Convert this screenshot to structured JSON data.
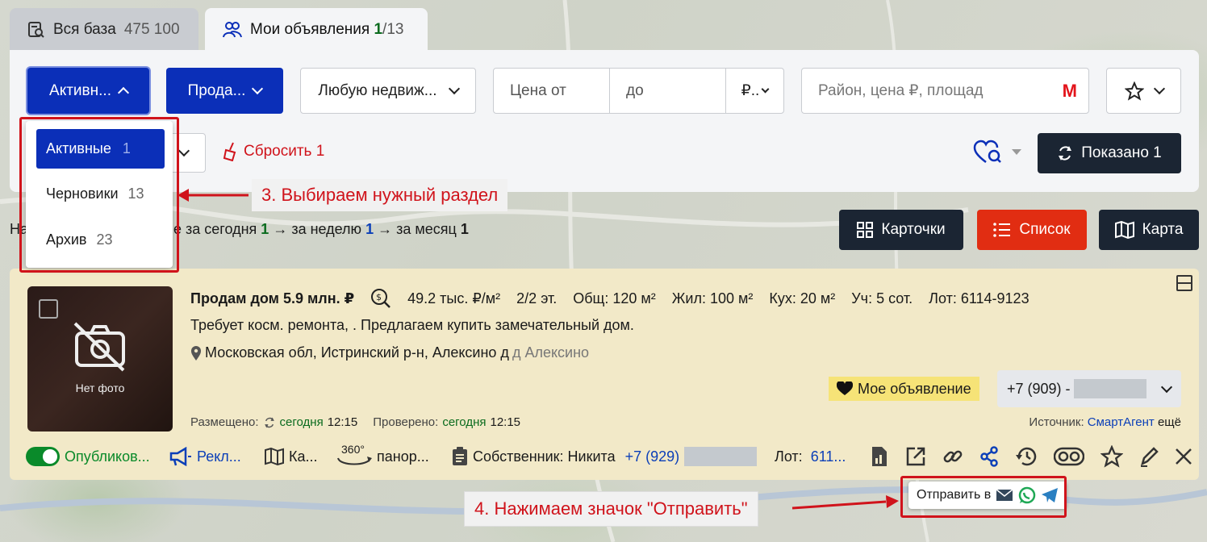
{
  "tabs": [
    {
      "label": "Вся база",
      "count": "475 100"
    },
    {
      "label": "Мои объявления",
      "active_count": "1",
      "total": "/13"
    }
  ],
  "filters": {
    "status": "Активн...",
    "deal": "Прода...",
    "property": "Любую недвиж...",
    "price_from": "Цена от",
    "price_to": "до",
    "currency": "₽..",
    "search_placeholder": "Район, цена ₽, площад",
    "metro_icon": "М",
    "reset": "Сбросить 1",
    "shown": "Показано 1"
  },
  "status_menu": [
    {
      "label": "Активные",
      "count": "1"
    },
    {
      "label": "Черновики",
      "count": "13"
    },
    {
      "label": "Архив",
      "count": "23"
    }
  ],
  "annotations": {
    "step3": "3. Выбираем нужный раздел",
    "step4": "4. Нажимаем значок \"Отправить\""
  },
  "stats": {
    "prefix": "На",
    "today_label": "е за сегодня",
    "today": "1",
    "week_label": "→ за неделю",
    "week": "1",
    "month_label": "→ за месяц",
    "month": "1"
  },
  "views": {
    "cards": "Карточки",
    "list": "Список",
    "map": "Карта"
  },
  "listing": {
    "title": "Продам дом 5.9 млн. ₽",
    "price_per_m": "49.2 тыс. ₽/м²",
    "floors": "2/2 эт.",
    "total": "Общ: 120 м²",
    "living": "Жил: 100 м²",
    "kitchen": "Кух: 20 м²",
    "plot": "Уч: 5 сот.",
    "lot": "Лот: 6114-9123",
    "description": "Требует косм. ремонта, . Предлагаем купить замечательный дом.",
    "address": "Московская обл, Истринский р-н, Алексино д",
    "address_extra": "д Алексино",
    "no_photo": "Нет фото",
    "my_badge": "Мое объявление",
    "phone": "+7 (909) -",
    "posted_label": "Размещено:",
    "posted": "сегодня",
    "posted_time": "12:15",
    "checked_label": "Проверено:",
    "checked": "сегодня",
    "checked_time": "12:15",
    "source_label": "Источник:",
    "source": "СмартАгент",
    "source_more": "ещё",
    "published": "Опубликов...",
    "ads": "Рекл...",
    "map_short": "Ка...",
    "pano_badge": "360°",
    "pano": "панор...",
    "owner": "Собственник: Никита",
    "owner_phone": "+7 (929)",
    "lot_short_label": "Лот:",
    "lot_short": "611..."
  },
  "share_tooltip": "Отправить в",
  "colors": {
    "blue": "#0b2fb8",
    "red": "#e12d12",
    "dark": "#1b2533",
    "card": "#f2e9c8",
    "annotation": "#d0131b"
  }
}
